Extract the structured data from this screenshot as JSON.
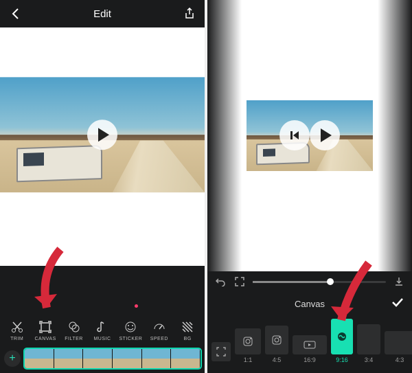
{
  "left": {
    "topbar": {
      "title": "Edit"
    },
    "toolbar": {
      "items": [
        {
          "id": "trim",
          "label": "TRIM"
        },
        {
          "id": "canvas",
          "label": "CANVAS"
        },
        {
          "id": "filter",
          "label": "FILTER"
        },
        {
          "id": "music",
          "label": "MUSIC"
        },
        {
          "id": "sticker",
          "label": "STICKER"
        },
        {
          "id": "speed",
          "label": "SPEED"
        },
        {
          "id": "bg",
          "label": "BG"
        }
      ]
    }
  },
  "right": {
    "panel_title": "Canvas",
    "ratios": [
      {
        "id": "expand",
        "label": ""
      },
      {
        "id": "1-1",
        "label": "1:1",
        "size": "sz-1-1",
        "icon": "instagram"
      },
      {
        "id": "4-5",
        "label": "4:5",
        "size": "sz-4-5",
        "icon": "instagram"
      },
      {
        "id": "16-9",
        "label": "16:9",
        "size": "sz-16-9",
        "icon": "youtube"
      },
      {
        "id": "9-16",
        "label": "9:16",
        "size": "sz-9-16",
        "icon": "app",
        "selected": true
      },
      {
        "id": "3-4",
        "label": "3:4",
        "size": "sz-3-4"
      },
      {
        "id": "4-3",
        "label": "4:3",
        "size": "sz-4-3"
      }
    ]
  },
  "colors": {
    "accent": "#18e0b2",
    "arrow": "#d6293a"
  }
}
